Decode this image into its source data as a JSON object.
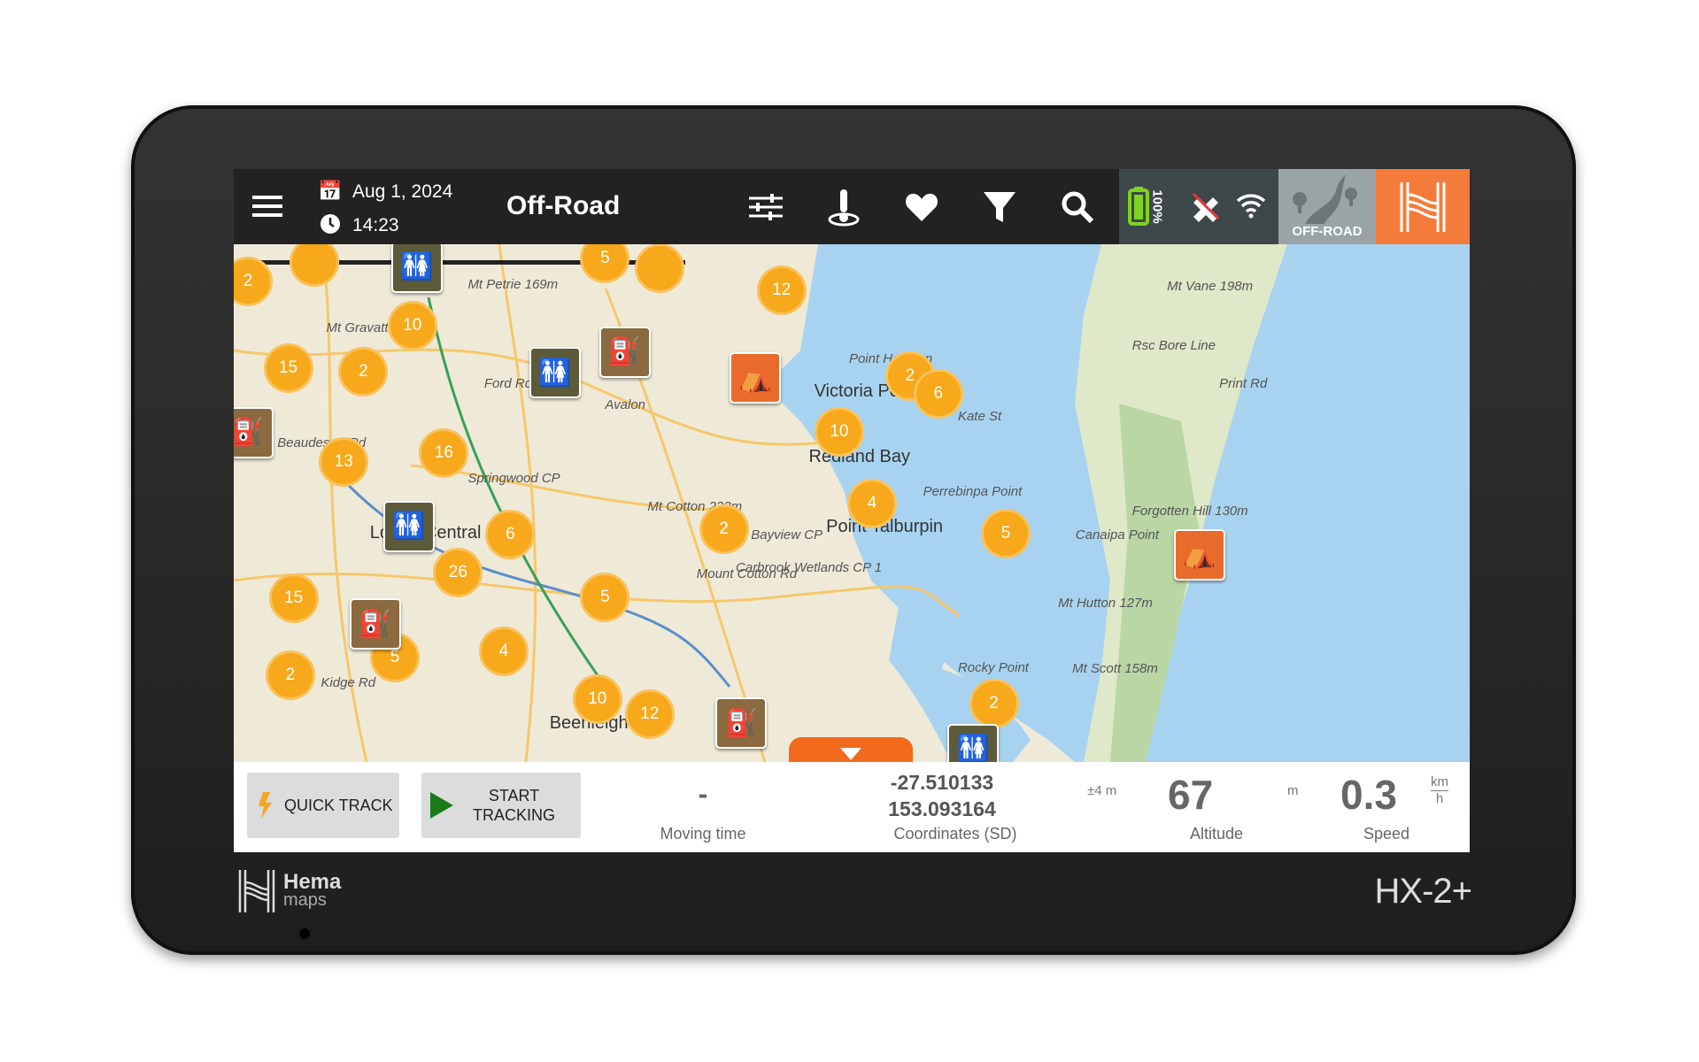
{
  "topbar": {
    "date": "Aug 1, 2024",
    "time": "14:23",
    "mode": "Off-Road",
    "battery": "100%",
    "offroad_badge": "OFF-ROAD",
    "icons": [
      "menu-icon",
      "calendar-icon",
      "clock-icon",
      "sliders-icon",
      "location-pin-icon",
      "heart-icon",
      "filter-icon",
      "search-icon",
      "battery-icon",
      "gps-off-icon",
      "wifi-icon",
      "offroad-mode-icon",
      "hema-logo-icon"
    ]
  },
  "colors": {
    "accent": "#f47b3a",
    "cluster": "#f7a81b",
    "battery": "#7ed321",
    "water": "#a8d3f0",
    "topbar": "#222222"
  },
  "map": {
    "clusters": [
      "2",
      "",
      "10",
      "15",
      "2",
      "13",
      "16",
      "6",
      "26",
      "15",
      "5",
      "4",
      "5",
      "2",
      "10",
      "12",
      "2",
      "12",
      "2",
      "6",
      "10",
      "4",
      "5",
      "2",
      "5",
      ""
    ],
    "pois": [
      "toilets",
      "toilets",
      "toilets",
      "toilets",
      "fuel",
      "fuel",
      "fuel",
      "fuel",
      "campsite",
      "campsite"
    ],
    "places": [
      "Victoria Point",
      "Redland Bay",
      "Point Talburpin",
      "Springwood CP",
      "Mt Cotton 233m",
      "Bayview CP",
      "Carbrook Wetlands CP 1",
      "Beenleigh",
      "Mt Vane 198m",
      "Forgotten Hill 130m",
      "Mt Hutton 127m",
      "Mt Scott 158m",
      "Canaipa Point",
      "Rocky Point",
      "Perrebinpa Point",
      "Point Halloran",
      "Kate St",
      "Rsc Bore Line",
      "Print Rd",
      "Mt Petrie 169m",
      "Mt Gravatt",
      "Ford Rd",
      "Avalon",
      "Beaudesert Rd",
      "Kidge Rd",
      "Logan Central",
      "Mount Cotton Rd"
    ]
  },
  "bottombar": {
    "quick_track": "QUICK TRACK",
    "start_tracking_1": "START",
    "start_tracking_2": "TRACKING",
    "moving_time_value": "-",
    "moving_time_label": "Moving time",
    "lat": "-27.510133",
    "lon": "153.093164",
    "coords_label": "Coordinates (SD)",
    "accuracy": "±4 m",
    "altitude": "67",
    "altitude_unit": "m",
    "altitude_label": "Altitude",
    "speed": "0.3",
    "speed_unit_top": "km",
    "speed_unit_bottom": "h",
    "speed_label": "Speed"
  },
  "device": {
    "brand": "Hema",
    "brand_sub": "maps",
    "model": "HX-2+"
  }
}
